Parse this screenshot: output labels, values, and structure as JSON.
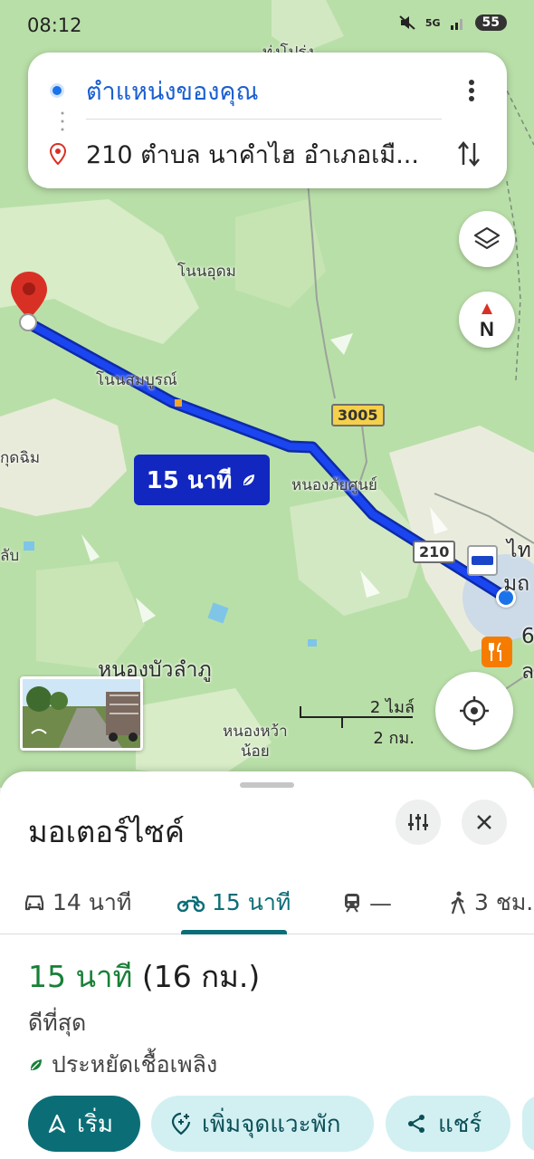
{
  "status_bar": {
    "time": "08:12",
    "network": "5G",
    "battery": "55"
  },
  "route_card": {
    "origin": "ตำแหน่งของคุณ",
    "destination": "210 ตำบล นาคำไฮ อำเภอเมื..."
  },
  "map": {
    "labels": {
      "top_partial": "ท่งโปร่ง",
      "non_udom": "โนนอุดม",
      "non_somboon": "โนนสมบูรณ์",
      "kud_chim": "กุดฉิม",
      "lab": "ลับ",
      "nong_phai_soon": "หนองภัยศูนย์",
      "nong_bua_lamphu": "หนองบัวลำภู",
      "nong_wa_noi": "หนองหว้า\nน้อย",
      "right_tho": "ไท",
      "right_mo": "มถ",
      "right_6": "6",
      "right_la": "ล"
    },
    "road_3005": "3005",
    "road_210": "210",
    "route_eta": "15 นาที",
    "scale_miles": "2 ไมล์",
    "scale_km": "2 กม."
  },
  "sheet": {
    "title": "มอเตอร์ไซค์",
    "modes": [
      {
        "name": "car",
        "label": "14 นาที"
      },
      {
        "name": "motorcycle",
        "label": "15 นาที"
      },
      {
        "name": "transit",
        "label": "—"
      },
      {
        "name": "walk",
        "label": "3 ชม."
      }
    ],
    "eta_time": "15 นาที",
    "eta_distance": "(16 กม.)",
    "route_note": "ดีที่สุด",
    "eco_note": "ประหยัดเชื้อเพลิง",
    "actions": {
      "start": "เริ่ม",
      "add_stop": "เพิ่มจุดแวะพัก",
      "share": "แชร์"
    }
  },
  "colors": {
    "route": "#1227c0",
    "accent": "#0b6e77",
    "eta_green": "#188038",
    "pin": "#d93025"
  }
}
